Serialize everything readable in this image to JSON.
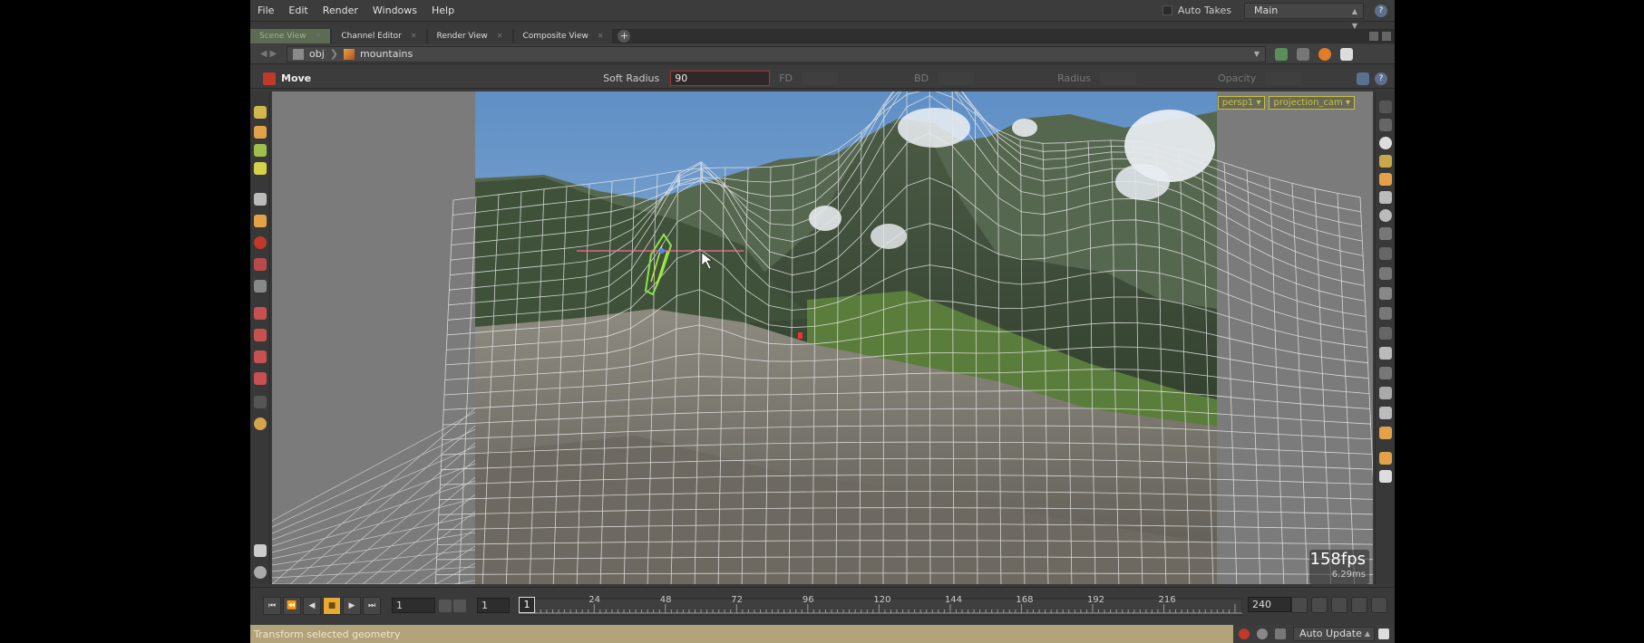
{
  "menubar": {
    "items": [
      "File",
      "Edit",
      "Render",
      "Windows",
      "Help"
    ],
    "auto_takes_label": "Auto Takes",
    "take_value": "Main"
  },
  "tabs": [
    {
      "label": "Scene View"
    },
    {
      "label": "Channel Editor"
    },
    {
      "label": "Render View"
    },
    {
      "label": "Composite View"
    }
  ],
  "path": {
    "root": "obj",
    "node": "mountains"
  },
  "operation": {
    "name": "Move",
    "soft_radius_label": "Soft Radius",
    "soft_radius_value": "90",
    "fd_label": "FD",
    "bd_label": "BD",
    "radius_label": "Radius",
    "opacity_label": "Opacity"
  },
  "viewport": {
    "camera_menu_1": "persp1 ▾",
    "camera_menu_2": "projection_cam ▾",
    "fps": "158fps",
    "frame_time": "6.29ms"
  },
  "playbar": {
    "current_frame": "1",
    "start_frame": "1",
    "start_small": "1",
    "end_frame": "240",
    "ticks": [
      "24",
      "48",
      "72",
      "96",
      "120",
      "144",
      "168",
      "192",
      "216"
    ]
  },
  "status": {
    "message": "Transform selected geometry",
    "auto_update": "Auto Update"
  },
  "colors": {
    "active_tab": "#5b6b54",
    "stop_button": "#e8a935",
    "status_bar": "#b3a37a",
    "camera_menu": "#c9c23a"
  }
}
